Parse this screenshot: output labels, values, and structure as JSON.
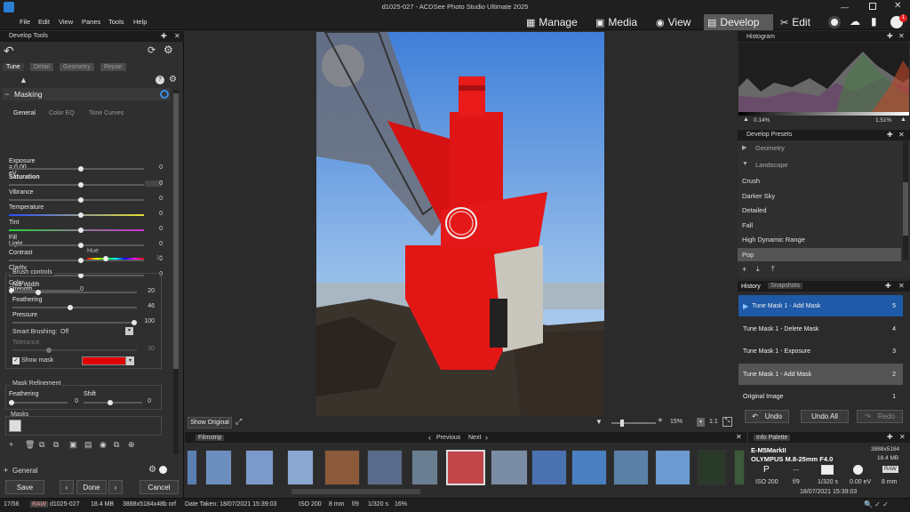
{
  "title": "d1025-027 - ACDSee Photo Studio Ultimate 2025",
  "menu": [
    "File",
    "Edit",
    "View",
    "Panes",
    "Tools",
    "Help"
  ],
  "modes": [
    "Manage",
    "Media",
    "View",
    "Develop",
    "Edit"
  ],
  "notification_count": "1",
  "develop_tools": {
    "title": "Develop Tools",
    "tabs": [
      "Tune",
      "Detail",
      "Geometry",
      "Repair"
    ],
    "section": "Masking",
    "subtabs": [
      "General",
      "Color EQ",
      "Tone Curves"
    ],
    "sliders": [
      {
        "label": "Exposure = 0.00 eV",
        "value": "0"
      },
      {
        "label": "Saturation",
        "value": "0"
      },
      {
        "label": "Vibrance",
        "value": "0"
      },
      {
        "label": "Temperature",
        "value": "0"
      },
      {
        "label": "Tint",
        "value": "0"
      },
      {
        "label": "Fill Light",
        "value": "0"
      },
      {
        "label": "Contrast",
        "value": "0"
      },
      {
        "label": "Clarity",
        "value": "0"
      },
      {
        "label": "Color Strength",
        "value": "0"
      }
    ],
    "hue_label": "Hue",
    "hue_value": "30",
    "brush_controls": "Brush controls",
    "nib_width": {
      "label": "Nib Width",
      "value": "20"
    },
    "feathering": {
      "label": "Feathering",
      "value": "46"
    },
    "pressure": {
      "label": "Pressure",
      "value": "100"
    },
    "smart_brushing": {
      "label": "Smart Brushing:",
      "value": "Off"
    },
    "tolerance": {
      "label": "Tolerance",
      "value": "30"
    },
    "show_mask": "Show mask",
    "mask_color": "#e00000",
    "mask_refinement": "Mask Refinement",
    "mr_feathering": {
      "label": "Feathering",
      "value": "0"
    },
    "mr_shift": {
      "label": "Shift",
      "value": "0"
    },
    "masks": "Masks",
    "general": "General",
    "save": "Save",
    "done": "Done",
    "cancel": "Cancel"
  },
  "viewer": {
    "show_original": "Show Original",
    "zoom": "15%",
    "ratio": "1:1"
  },
  "histogram": {
    "title": "Histogram",
    "left_pct": "0.14%",
    "right_pct": "1.51%"
  },
  "presets": {
    "title": "Develop Presets",
    "groups": [
      "Geometry",
      "Landscape"
    ],
    "items": [
      "Crush",
      "Darker Sky",
      "Detailed",
      "Fall",
      "High Dynamic Range",
      "Pop"
    ]
  },
  "history": {
    "tabs": [
      "History",
      "Snapshots"
    ],
    "items": [
      {
        "label": "Tune Mask 1 - Add Mask",
        "num": "5"
      },
      {
        "label": "Tune Mask 1 - Delete Mask",
        "num": "4"
      },
      {
        "label": "Tune Mask 1 - Exposure",
        "num": "3"
      },
      {
        "label": "Tune Mask 1 - Add Mask",
        "num": "2"
      },
      {
        "label": "Original Image",
        "num": "1"
      }
    ],
    "undo": "Undo",
    "undo_all": "Undo All",
    "redo": "Redo"
  },
  "filmstrip": {
    "title": "Filmstrip",
    "previous": "Previous",
    "next": "Next"
  },
  "info": {
    "title": "Info Palette",
    "camera": "E-M5MarkII",
    "dims": "3888x5184",
    "lens": "OLYMPUS M.8-25mm F4.0",
    "size": "18.4 MB",
    "mode": "P",
    "dash": "---",
    "raw": "RAW",
    "iso": "ISO 200",
    "fstop": "f/9",
    "shutter": "1/320 s",
    "ev": "0.00 eV",
    "focal": "8 mm",
    "date": "18/07/2021 15:39:03"
  },
  "status": {
    "index": "17/56",
    "raw": "RAW",
    "file": "d1025-027",
    "size": "18.4 MB",
    "dims": "3888x5184x48b orf",
    "date": "Date Taken: 18/07/2021 15:39:03",
    "iso": "ISO 200",
    "focal": "8 mm",
    "fstop": "f/9",
    "shutter": "1/320 s",
    "zoom": "16%"
  }
}
